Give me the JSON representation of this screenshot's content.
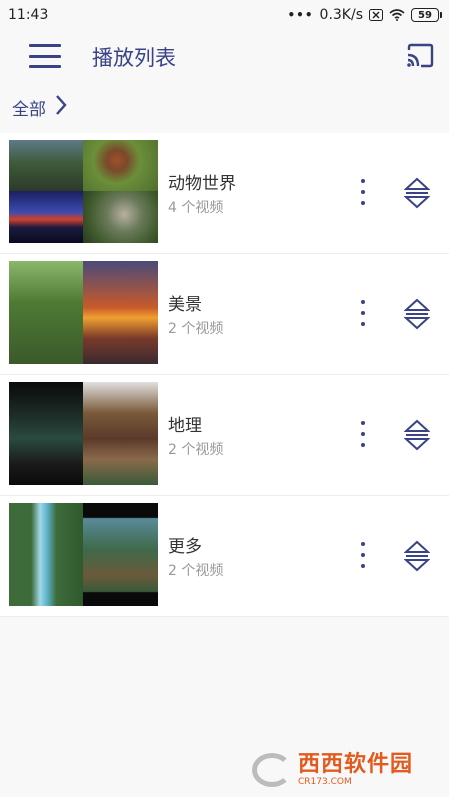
{
  "status_bar": {
    "time": "11:43",
    "dots": "•••",
    "speed": "0.3K/s",
    "battery": "59"
  },
  "header": {
    "title": "播放列表"
  },
  "breadcrumb": {
    "label": "全部"
  },
  "playlists": [
    {
      "title": "动物世界",
      "subtitle": "4 个视频",
      "thumbs": [
        "#4a6b3a",
        "#6b8f3a",
        "#1e2a5a",
        "#3f5a2c"
      ]
    },
    {
      "title": "美景",
      "subtitle": "2 个视频",
      "thumbs": [
        "#4f7a34",
        "#c85a2a",
        "#5a7a40",
        "#7a3a2a"
      ]
    },
    {
      "title": "地理",
      "subtitle": "2 个视频",
      "thumbs": [
        "#1c1c1c",
        "#7a5a3a",
        "#2a3a2a",
        "#8a6a4a"
      ]
    },
    {
      "title": "更多",
      "subtitle": "2 个视频",
      "thumbs": [
        "#3d6b3a",
        "#1a1a1a",
        "#5ab0c8",
        "#3f6a4a"
      ]
    }
  ],
  "colors": {
    "accent": "#3a4386",
    "subtitle": "#999999",
    "background": "#f8f8f8"
  },
  "icons": {
    "menu": "hamburger-icon",
    "cast": "cast-icon",
    "chevron": "chevron-right-icon",
    "more": "more-vertical-icon",
    "sort": "reorder-icon"
  }
}
